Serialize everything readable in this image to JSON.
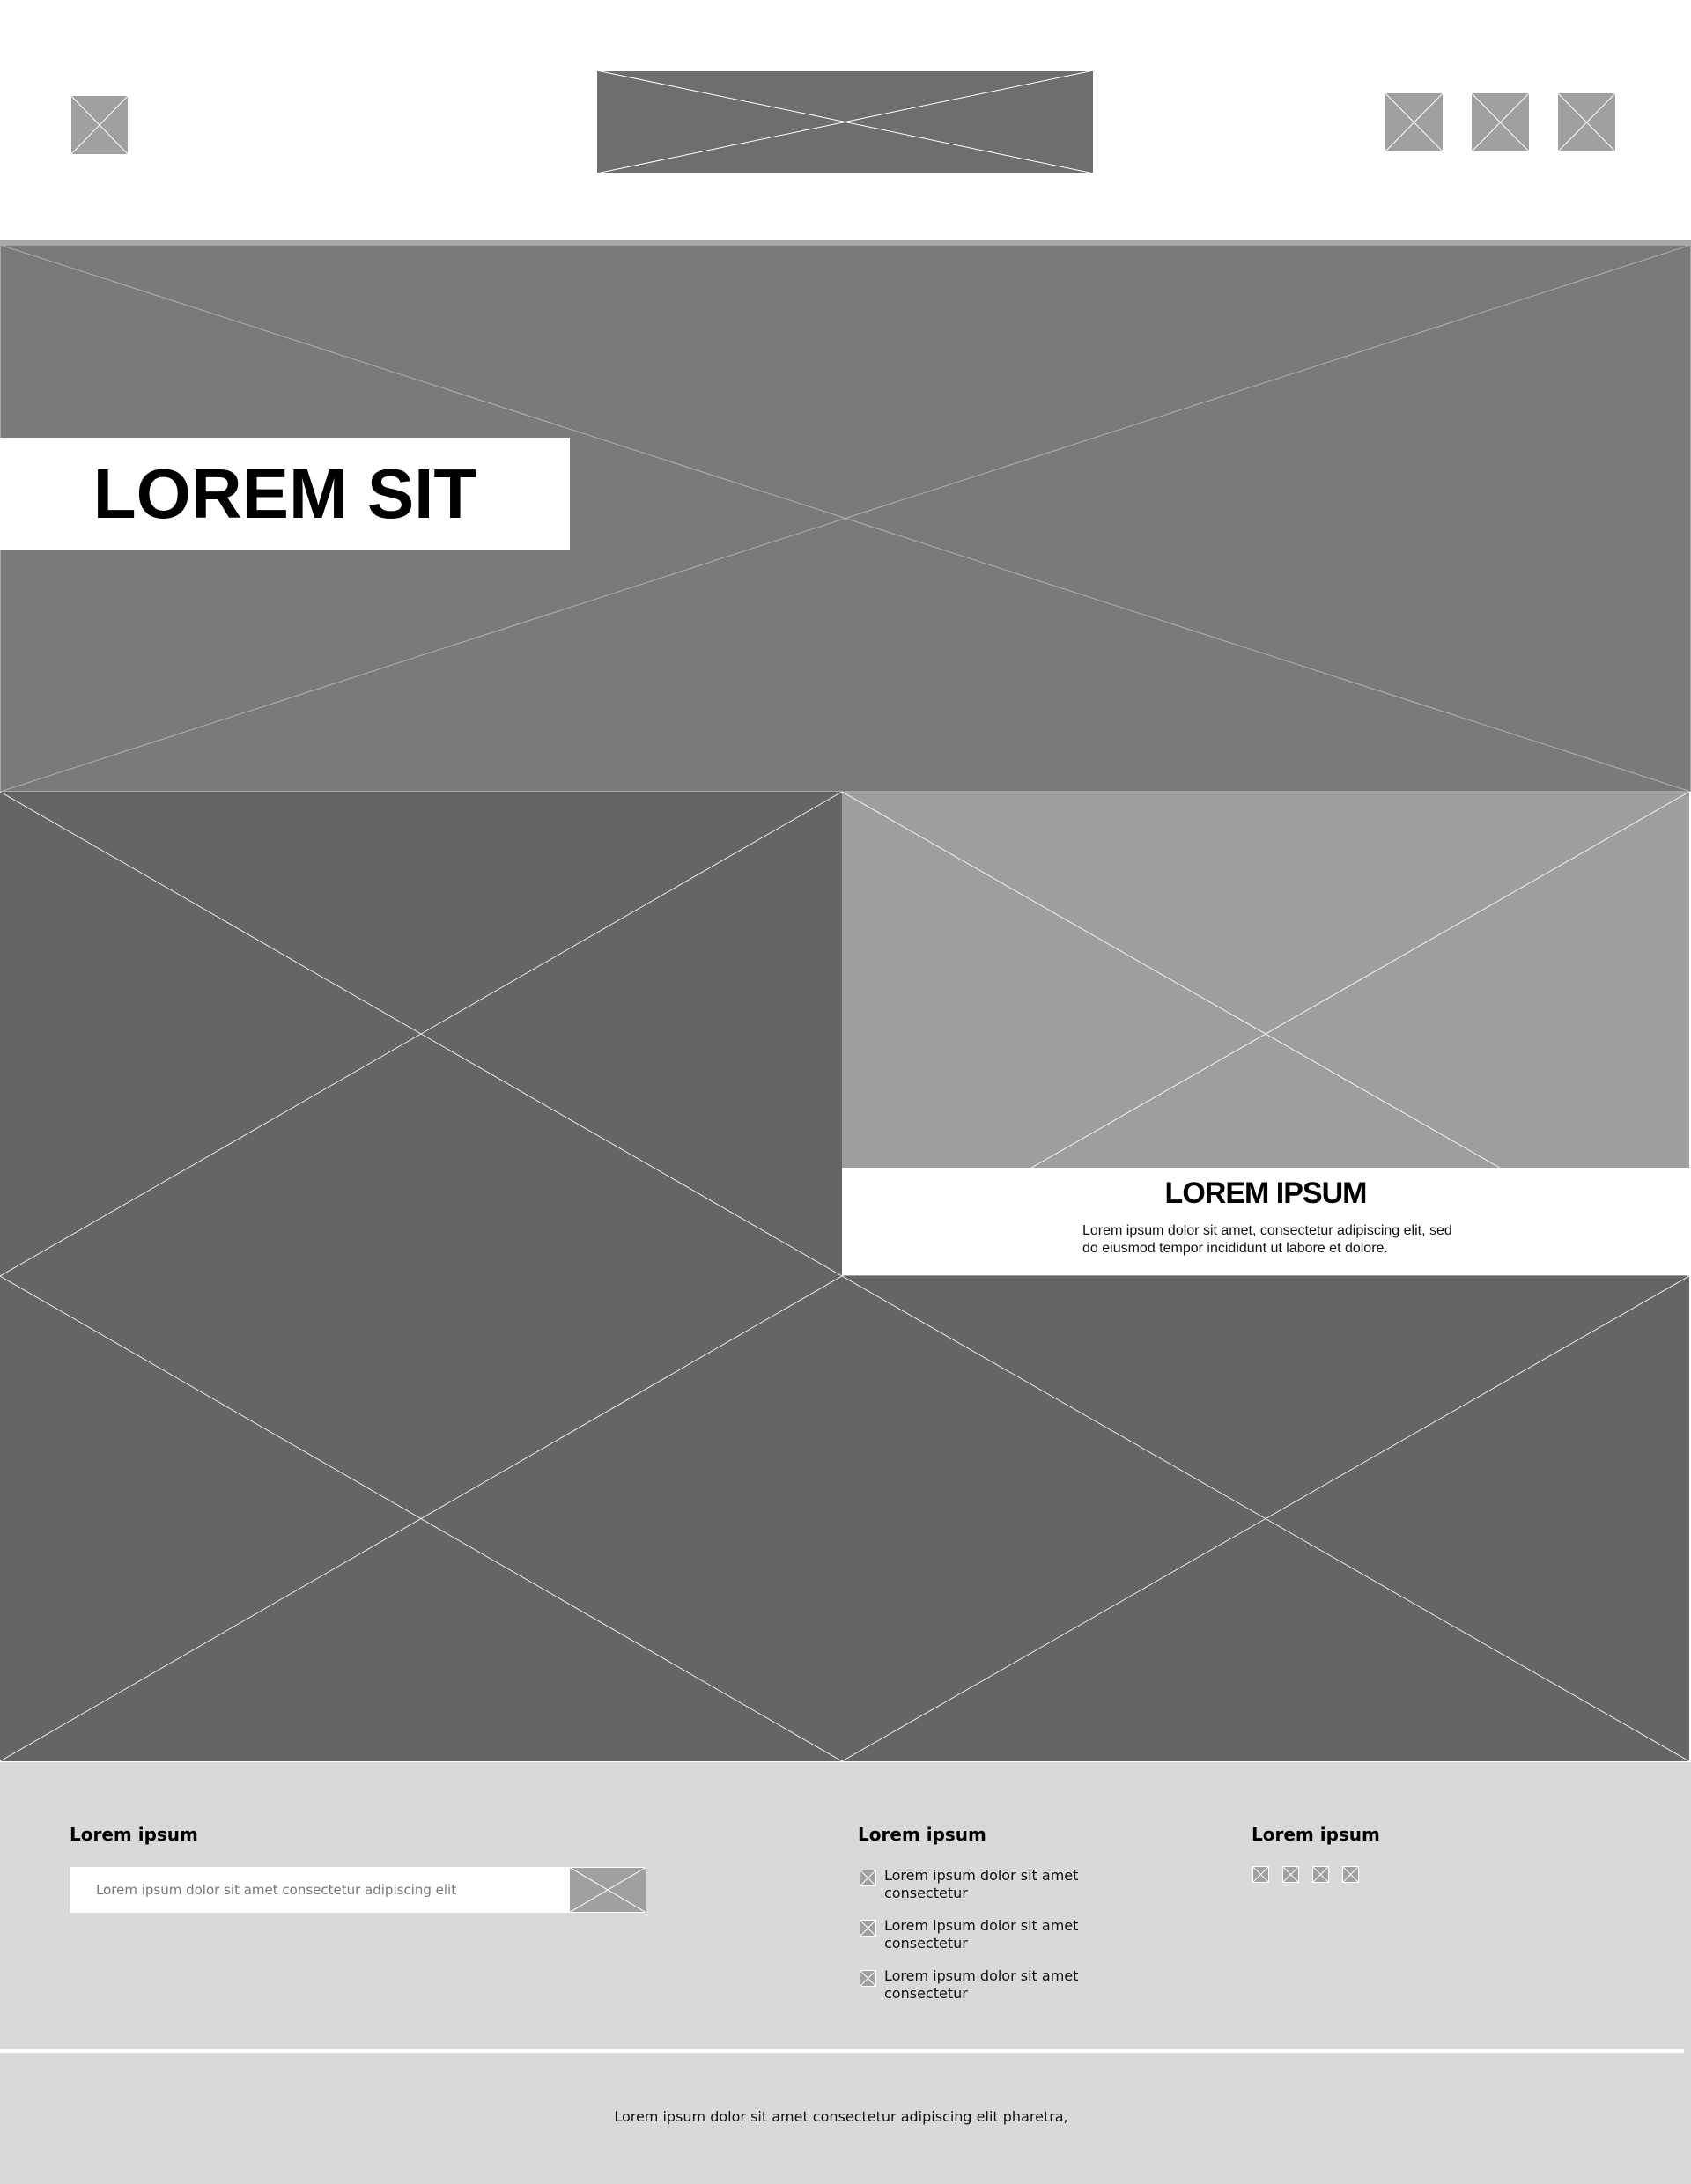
{
  "colors": {
    "placeholder_light": "#a0a0a0",
    "placeholder_dark": "#6e6e70",
    "hero_bg": "#7a7a7a",
    "tile_dark": "#656565",
    "tile_light": "#9e9e9e",
    "footer_bg": "#d9d9d9"
  },
  "header": {
    "logo_icon": "image-placeholder-icon",
    "banner_icon": "image-placeholder-icon",
    "action_icons": [
      "image-placeholder-icon",
      "image-placeholder-icon",
      "image-placeholder-icon"
    ]
  },
  "hero": {
    "title": "LOREM SIT"
  },
  "feature_card": {
    "title": "LOREM IPSUM",
    "body": "Lorem ipsum dolor sit amet, consectetur adipiscing elit, sed do eiusmod tempor incididunt ut labore et dolore."
  },
  "footer": {
    "newsletter": {
      "heading": "Lorem ipsum",
      "placeholder": "Lorem ipsum dolor sit amet consectetur adipiscing elit"
    },
    "contact": {
      "heading": "Lorem ipsum",
      "items": [
        "Lorem ipsum dolor sit amet consectetur",
        "Lorem ipsum dolor sit amet consectetur",
        "Lorem ipsum dolor sit amet consectetur"
      ]
    },
    "social": {
      "heading": "Lorem ipsum",
      "icons": [
        "image-placeholder-icon",
        "image-placeholder-icon",
        "image-placeholder-icon",
        "image-placeholder-icon"
      ]
    },
    "copyright": "Lorem ipsum dolor sit amet consectetur adipiscing elit pharetra,"
  }
}
